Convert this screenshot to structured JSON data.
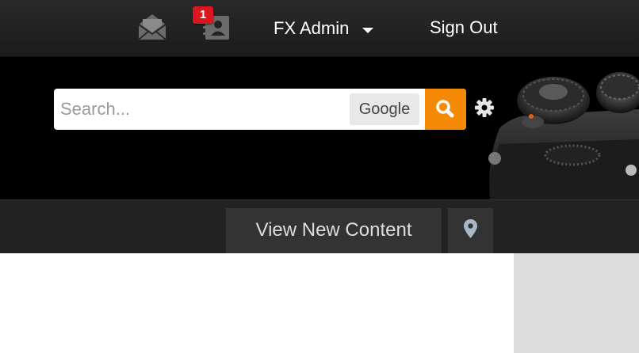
{
  "userbar": {
    "notification_count": "1",
    "user_name": "FX Admin",
    "signout_label": "Sign Out",
    "icons": [
      "envelope-icon",
      "contact-card-icon",
      "caret-down-icon"
    ]
  },
  "search": {
    "placeholder": "Search...",
    "value": "",
    "engine_label": "Google",
    "submit_icon": "magnifier-icon",
    "accent_color": "#f58a07"
  },
  "header": {
    "settings_icon": "gear-icon",
    "banner_image": "camera-dials"
  },
  "nav": {
    "view_new_content_label": "View New Content",
    "location_icon": "map-pin-icon"
  },
  "colors": {
    "topbar": "#1f1f1f",
    "header": "#000000",
    "nav": "#222222",
    "badge": "#d8171f",
    "sidebar": "#dcdcdc"
  }
}
